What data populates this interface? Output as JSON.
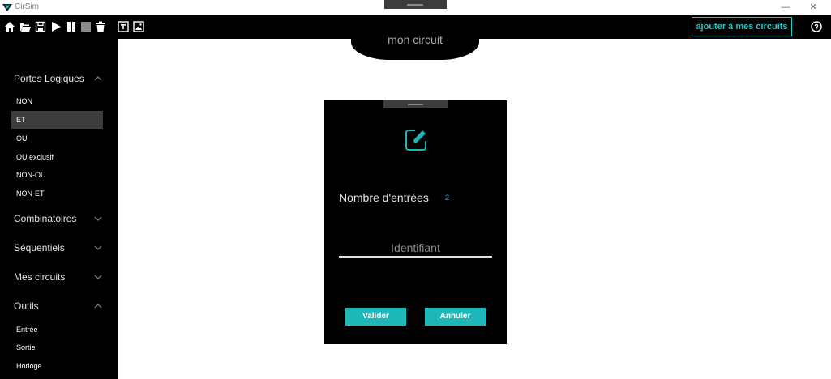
{
  "window": {
    "title": "CirSim",
    "controls": {
      "minimize": "—",
      "restore": "❐",
      "close": "✕"
    }
  },
  "toolbar": {
    "icons": [
      "home-icon",
      "open-folder-icon",
      "save-icon",
      "play-icon",
      "pause-icon",
      "stop-icon",
      "delete-icon",
      "text-tool-icon",
      "image-tool-icon"
    ],
    "add_button": "ajouter à mes circuits",
    "help_icon": "help-icon"
  },
  "circuit": {
    "name": "mon circuit"
  },
  "sidebar": {
    "sections": [
      {
        "label": "Portes Logiques",
        "expanded": true,
        "items": [
          "NON",
          "ET",
          "OU",
          "OU exclusif",
          "NON-OU",
          "NON-ET"
        ],
        "selected": "ET"
      },
      {
        "label": "Combinatoires",
        "expanded": false
      },
      {
        "label": "Séquentiels",
        "expanded": false
      },
      {
        "label": "Mes circuits",
        "expanded": false
      },
      {
        "label": "Outils",
        "expanded": true,
        "items": [
          "Entrée",
          "Sortie",
          "Horloge"
        ]
      }
    ]
  },
  "dialog": {
    "icon": "edit-icon",
    "inputs_label": "Nombre d'entrées",
    "inputs_value": "2",
    "identifier_placeholder": "Identifiant",
    "identifier_value": "",
    "confirm_label": "Valider",
    "cancel_label": "Annuler"
  },
  "colors": {
    "accent": "#1fb8b8",
    "background": "#000000",
    "canvas": "#ffffff"
  }
}
